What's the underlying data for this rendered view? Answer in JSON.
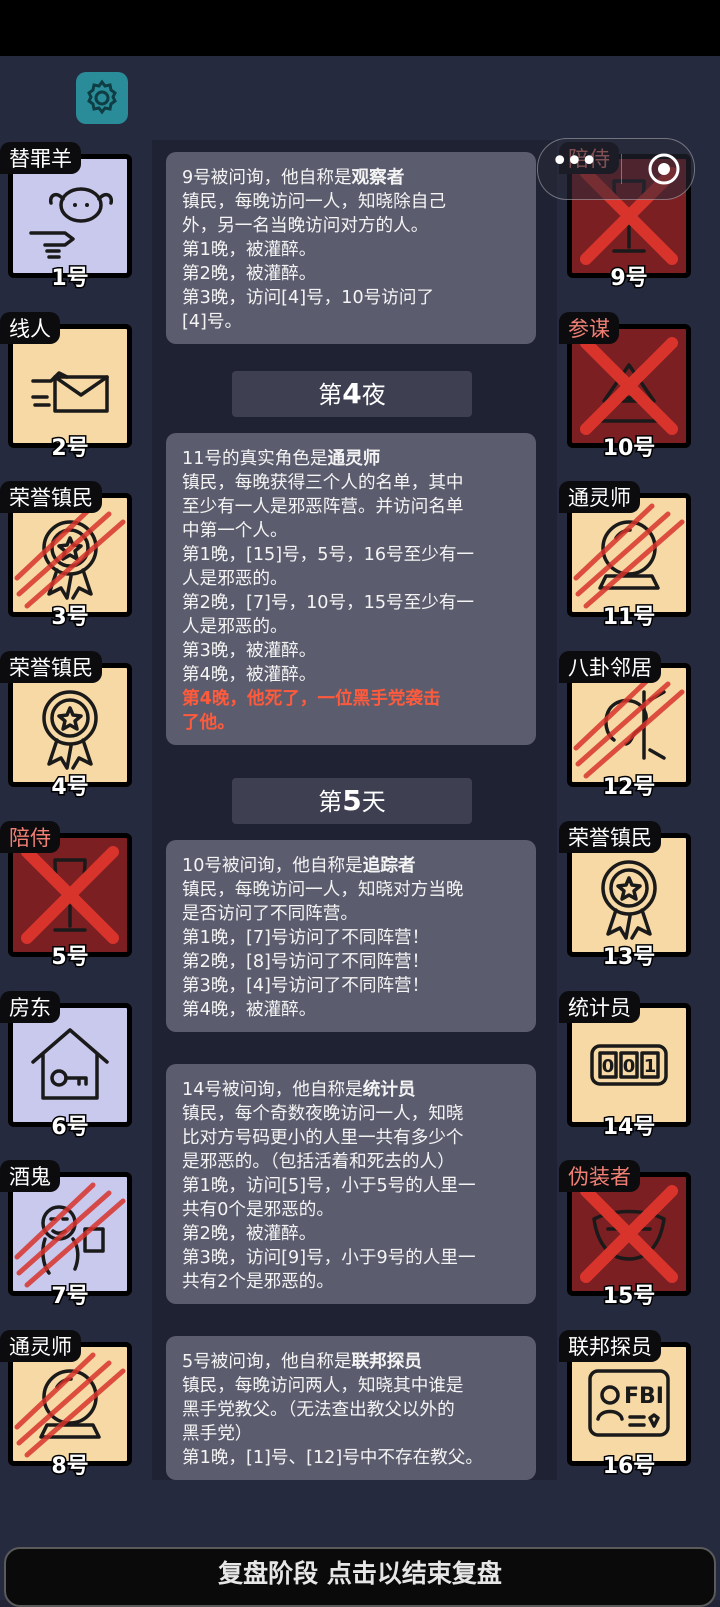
{
  "players_left": [
    {
      "role": "替罪羊",
      "seat": "1号",
      "dead": false,
      "bg": "lav",
      "icon": "scapegoat-icon",
      "scratch": false
    },
    {
      "role": "线人",
      "seat": "2号",
      "dead": false,
      "bg": "tan",
      "icon": "letter-icon",
      "scratch": false
    },
    {
      "role": "荣誉镇民",
      "seat": "3号",
      "dead": false,
      "bg": "tan",
      "icon": "medal-icon",
      "scratch": true
    },
    {
      "role": "荣誉镇民",
      "seat": "4号",
      "dead": false,
      "bg": "tan",
      "icon": "medal-icon",
      "scratch": false
    },
    {
      "role": "陪侍",
      "seat": "5号",
      "dead": true,
      "bg": "red",
      "icon": "wine-glass-icon",
      "scratch": false
    },
    {
      "role": "房东",
      "seat": "6号",
      "dead": false,
      "bg": "lav",
      "icon": "house-key-icon",
      "scratch": false
    },
    {
      "role": "酒鬼",
      "seat": "7号",
      "dead": false,
      "bg": "lav",
      "icon": "drunk-icon",
      "scratch": true
    },
    {
      "role": "通灵师",
      "seat": "8号",
      "dead": false,
      "bg": "tan",
      "icon": "crystal-ball-icon",
      "scratch": true
    }
  ],
  "players_right": [
    {
      "role": "陪侍",
      "seat": "9号",
      "dead": true,
      "bg": "red",
      "icon": "wine-glass-icon",
      "scratch": false
    },
    {
      "role": "参谋",
      "seat": "10号",
      "dead": true,
      "bg": "red",
      "icon": "strategist-icon",
      "scratch": false
    },
    {
      "role": "通灵师",
      "seat": "11号",
      "dead": false,
      "bg": "tan",
      "icon": "crystal-ball-icon",
      "scratch": true
    },
    {
      "role": "八卦邻居",
      "seat": "12号",
      "dead": false,
      "bg": "tan",
      "icon": "ear-icon",
      "scratch": true
    },
    {
      "role": "荣誉镇民",
      "seat": "13号",
      "dead": false,
      "bg": "tan",
      "icon": "medal-icon",
      "scratch": false
    },
    {
      "role": "统计员",
      "seat": "14号",
      "dead": false,
      "bg": "tan",
      "icon": "counter-icon",
      "scratch": false
    },
    {
      "role": "伪装者",
      "seat": "15号",
      "dead": true,
      "bg": "red",
      "icon": "mask-icon",
      "scratch": false
    },
    {
      "role": "联邦探员",
      "seat": "16号",
      "dead": false,
      "bg": "tan",
      "icon": "fbi-badge-icon",
      "scratch": false
    }
  ],
  "log": {
    "entry1": {
      "head_pre": "9号被问询，他自称是",
      "head_role": "观察者",
      "lines": [
        "镇民，每晚访问一人，知晓除自己",
        "外，另一名当晚访问对方的人。",
        "第1晚，被灌醉。",
        "第2晚，被灌醉。",
        "第3晚，访问[4]号，10号访问了",
        "[4]号。"
      ]
    },
    "phase1": {
      "pre": "第",
      "num": "4",
      "post": "夜"
    },
    "entry2": {
      "head_pre": "11号的真实角色是",
      "head_role": "通灵师",
      "lines": [
        "镇民，每晚获得三个人的名单，其中",
        "至少有一人是邪恶阵营。并访问名单",
        "中第一个人。",
        "第1晚，[15]号，5号，16号至少有一",
        "人是邪恶的。",
        "第2晚，[7]号，10号，15号至少有一",
        "人是邪恶的。",
        "第3晚，被灌醉。",
        "第4晚，被灌醉。"
      ],
      "death_lines": [
        "第4晚，他死了，一位黑手党袭击",
        "了他。"
      ]
    },
    "phase2": {
      "pre": "第",
      "num": "5",
      "post": "天"
    },
    "entry3": {
      "head_pre": "10号被问询，他自称是",
      "head_role": "追踪者",
      "lines": [
        "镇民，每晚访问一人，知晓对方当晚",
        "是否访问了不同阵营。",
        "第1晚，[7]号访问了不同阵营！",
        "第2晚，[8]号访问了不同阵营！",
        "第3晚，[4]号访问了不同阵营！",
        "第4晚，被灌醉。"
      ]
    },
    "entry4": {
      "head_pre": "14号被问询，他自称是",
      "head_role": "统计员",
      "lines": [
        "镇民，每个奇数夜晚访问一人，知晓",
        "比对方号码更小的人里一共有多少个",
        "是邪恶的。（包括活着和死去的人）",
        "第1晚，访问[5]号，小于5号的人里一",
        "共有0个是邪恶的。",
        "第2晚，被灌醉。",
        "第3晚，访问[9]号，小于9号的人里一",
        "共有2个是邪恶的。"
      ]
    },
    "entry5": {
      "head_pre": "5号被问询，他自称是",
      "head_role": "联邦探员",
      "lines": [
        "镇民，每晚访问两人，知晓其中谁是",
        "黑手党教父。（无法查出教父以外的",
        "黑手党）",
        "第1晚，[1]号、[12]号中不存在教父。"
      ]
    }
  },
  "footer": {
    "end_review": "复盘阶段 点击以结束复盘"
  },
  "colors": {
    "dead_role": "#f07f74",
    "death_text": "#ff5a3c",
    "settings": "#2a8c98"
  }
}
